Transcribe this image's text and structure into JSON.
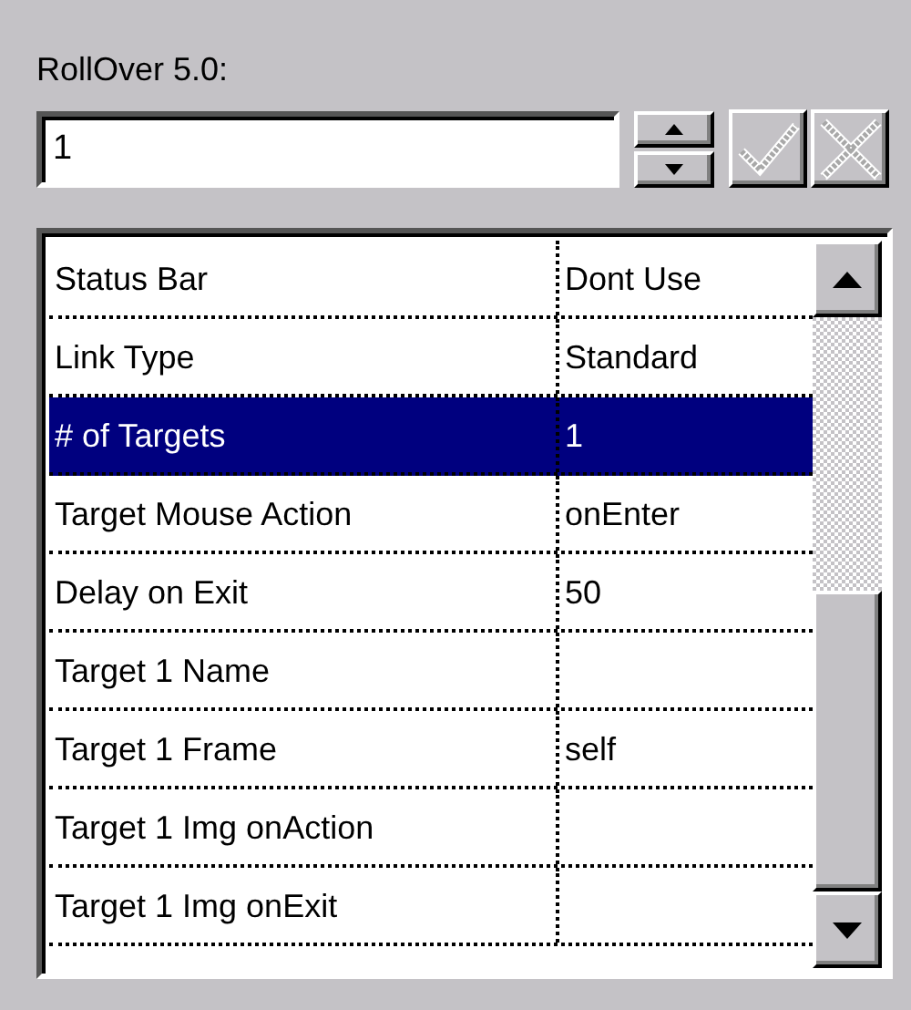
{
  "label": "RollOver 5.0:",
  "field": {
    "value": "1"
  },
  "buttons": [
    {
      "kind": "apply",
      "disabled": true
    },
    {
      "kind": "cancel",
      "disabled": true
    }
  ],
  "properties": [
    {
      "name": "Status Bar",
      "value": "Dont Use",
      "selected": false
    },
    {
      "name": "Link Type",
      "value": "Standard",
      "selected": false
    },
    {
      "name": "# of Targets",
      "value": "1",
      "selected": true
    },
    {
      "name": "Target Mouse Action",
      "value": "onEnter",
      "selected": false
    },
    {
      "name": "Delay on Exit",
      "value": "50",
      "selected": false
    },
    {
      "name": "Target 1 Name",
      "selected": false
    },
    {
      "name": "Target 1 Frame",
      "value": "self",
      "selected": false
    },
    {
      "name": "Target 1 Img onAction",
      "selected": false
    },
    {
      "name": "Target 1 Img onExit",
      "selected": false
    }
  ]
}
